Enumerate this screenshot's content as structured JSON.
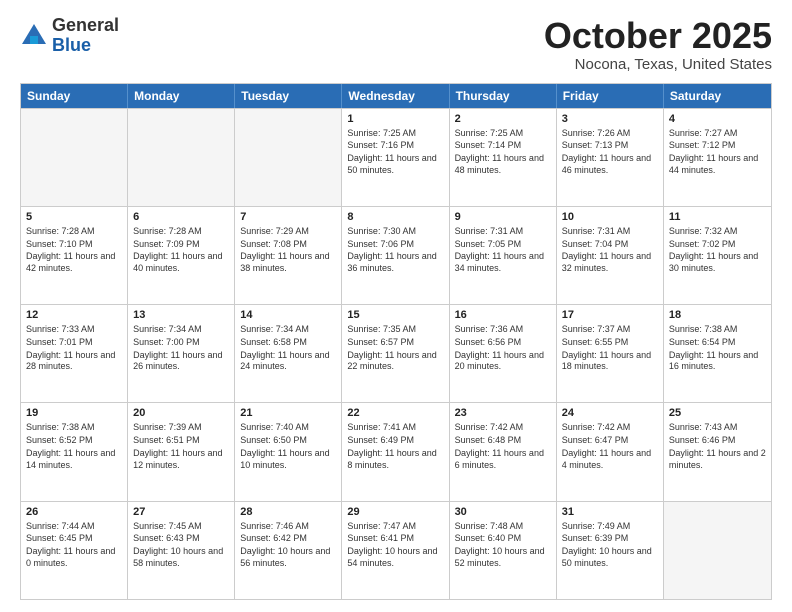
{
  "logo": {
    "general": "General",
    "blue": "Blue"
  },
  "title": {
    "month": "October 2025",
    "location": "Nocona, Texas, United States"
  },
  "weekdays": [
    "Sunday",
    "Monday",
    "Tuesday",
    "Wednesday",
    "Thursday",
    "Friday",
    "Saturday"
  ],
  "weeks": [
    [
      {
        "day": "",
        "sunrise": "",
        "sunset": "",
        "daylight": "",
        "empty": true
      },
      {
        "day": "",
        "sunrise": "",
        "sunset": "",
        "daylight": "",
        "empty": true
      },
      {
        "day": "",
        "sunrise": "",
        "sunset": "",
        "daylight": "",
        "empty": true
      },
      {
        "day": "1",
        "sunrise": "Sunrise: 7:25 AM",
        "sunset": "Sunset: 7:16 PM",
        "daylight": "Daylight: 11 hours and 50 minutes."
      },
      {
        "day": "2",
        "sunrise": "Sunrise: 7:25 AM",
        "sunset": "Sunset: 7:14 PM",
        "daylight": "Daylight: 11 hours and 48 minutes."
      },
      {
        "day": "3",
        "sunrise": "Sunrise: 7:26 AM",
        "sunset": "Sunset: 7:13 PM",
        "daylight": "Daylight: 11 hours and 46 minutes."
      },
      {
        "day": "4",
        "sunrise": "Sunrise: 7:27 AM",
        "sunset": "Sunset: 7:12 PM",
        "daylight": "Daylight: 11 hours and 44 minutes."
      }
    ],
    [
      {
        "day": "5",
        "sunrise": "Sunrise: 7:28 AM",
        "sunset": "Sunset: 7:10 PM",
        "daylight": "Daylight: 11 hours and 42 minutes."
      },
      {
        "day": "6",
        "sunrise": "Sunrise: 7:28 AM",
        "sunset": "Sunset: 7:09 PM",
        "daylight": "Daylight: 11 hours and 40 minutes."
      },
      {
        "day": "7",
        "sunrise": "Sunrise: 7:29 AM",
        "sunset": "Sunset: 7:08 PM",
        "daylight": "Daylight: 11 hours and 38 minutes."
      },
      {
        "day": "8",
        "sunrise": "Sunrise: 7:30 AM",
        "sunset": "Sunset: 7:06 PM",
        "daylight": "Daylight: 11 hours and 36 minutes."
      },
      {
        "day": "9",
        "sunrise": "Sunrise: 7:31 AM",
        "sunset": "Sunset: 7:05 PM",
        "daylight": "Daylight: 11 hours and 34 minutes."
      },
      {
        "day": "10",
        "sunrise": "Sunrise: 7:31 AM",
        "sunset": "Sunset: 7:04 PM",
        "daylight": "Daylight: 11 hours and 32 minutes."
      },
      {
        "day": "11",
        "sunrise": "Sunrise: 7:32 AM",
        "sunset": "Sunset: 7:02 PM",
        "daylight": "Daylight: 11 hours and 30 minutes."
      }
    ],
    [
      {
        "day": "12",
        "sunrise": "Sunrise: 7:33 AM",
        "sunset": "Sunset: 7:01 PM",
        "daylight": "Daylight: 11 hours and 28 minutes."
      },
      {
        "day": "13",
        "sunrise": "Sunrise: 7:34 AM",
        "sunset": "Sunset: 7:00 PM",
        "daylight": "Daylight: 11 hours and 26 minutes."
      },
      {
        "day": "14",
        "sunrise": "Sunrise: 7:34 AM",
        "sunset": "Sunset: 6:58 PM",
        "daylight": "Daylight: 11 hours and 24 minutes."
      },
      {
        "day": "15",
        "sunrise": "Sunrise: 7:35 AM",
        "sunset": "Sunset: 6:57 PM",
        "daylight": "Daylight: 11 hours and 22 minutes."
      },
      {
        "day": "16",
        "sunrise": "Sunrise: 7:36 AM",
        "sunset": "Sunset: 6:56 PM",
        "daylight": "Daylight: 11 hours and 20 minutes."
      },
      {
        "day": "17",
        "sunrise": "Sunrise: 7:37 AM",
        "sunset": "Sunset: 6:55 PM",
        "daylight": "Daylight: 11 hours and 18 minutes."
      },
      {
        "day": "18",
        "sunrise": "Sunrise: 7:38 AM",
        "sunset": "Sunset: 6:54 PM",
        "daylight": "Daylight: 11 hours and 16 minutes."
      }
    ],
    [
      {
        "day": "19",
        "sunrise": "Sunrise: 7:38 AM",
        "sunset": "Sunset: 6:52 PM",
        "daylight": "Daylight: 11 hours and 14 minutes."
      },
      {
        "day": "20",
        "sunrise": "Sunrise: 7:39 AM",
        "sunset": "Sunset: 6:51 PM",
        "daylight": "Daylight: 11 hours and 12 minutes."
      },
      {
        "day": "21",
        "sunrise": "Sunrise: 7:40 AM",
        "sunset": "Sunset: 6:50 PM",
        "daylight": "Daylight: 11 hours and 10 minutes."
      },
      {
        "day": "22",
        "sunrise": "Sunrise: 7:41 AM",
        "sunset": "Sunset: 6:49 PM",
        "daylight": "Daylight: 11 hours and 8 minutes."
      },
      {
        "day": "23",
        "sunrise": "Sunrise: 7:42 AM",
        "sunset": "Sunset: 6:48 PM",
        "daylight": "Daylight: 11 hours and 6 minutes."
      },
      {
        "day": "24",
        "sunrise": "Sunrise: 7:42 AM",
        "sunset": "Sunset: 6:47 PM",
        "daylight": "Daylight: 11 hours and 4 minutes."
      },
      {
        "day": "25",
        "sunrise": "Sunrise: 7:43 AM",
        "sunset": "Sunset: 6:46 PM",
        "daylight": "Daylight: 11 hours and 2 minutes."
      }
    ],
    [
      {
        "day": "26",
        "sunrise": "Sunrise: 7:44 AM",
        "sunset": "Sunset: 6:45 PM",
        "daylight": "Daylight: 11 hours and 0 minutes."
      },
      {
        "day": "27",
        "sunrise": "Sunrise: 7:45 AM",
        "sunset": "Sunset: 6:43 PM",
        "daylight": "Daylight: 10 hours and 58 minutes."
      },
      {
        "day": "28",
        "sunrise": "Sunrise: 7:46 AM",
        "sunset": "Sunset: 6:42 PM",
        "daylight": "Daylight: 10 hours and 56 minutes."
      },
      {
        "day": "29",
        "sunrise": "Sunrise: 7:47 AM",
        "sunset": "Sunset: 6:41 PM",
        "daylight": "Daylight: 10 hours and 54 minutes."
      },
      {
        "day": "30",
        "sunrise": "Sunrise: 7:48 AM",
        "sunset": "Sunset: 6:40 PM",
        "daylight": "Daylight: 10 hours and 52 minutes."
      },
      {
        "day": "31",
        "sunrise": "Sunrise: 7:49 AM",
        "sunset": "Sunset: 6:39 PM",
        "daylight": "Daylight: 10 hours and 50 minutes."
      },
      {
        "day": "",
        "sunrise": "",
        "sunset": "",
        "daylight": "",
        "empty": true
      }
    ]
  ]
}
